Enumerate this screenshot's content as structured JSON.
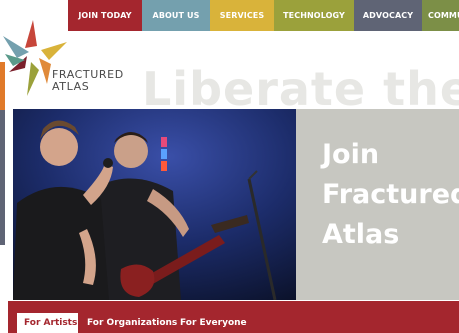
{
  "nav": {
    "items": [
      {
        "label": "JOIN TODAY",
        "color": "#a4262e"
      },
      {
        "label": "ABOUT US",
        "color": "#74a0ae"
      },
      {
        "label": "SERVICES",
        "color": "#d9b33a"
      },
      {
        "label": "TECHNOLOGY",
        "color": "#9ba13b"
      },
      {
        "label": "ADVOCACY",
        "color": "#5f6475"
      },
      {
        "label": "COMMU",
        "color": "#7c8f47"
      }
    ]
  },
  "logo": {
    "line1": "FRACTURED",
    "line2": "ATLAS"
  },
  "slogan": "Liberate the",
  "hero": {
    "title_line1": "Join",
    "title_line2": "Fractured",
    "title_line3": "Atlas",
    "photo_icon": "band-performance-photo"
  },
  "tabs": [
    {
      "label": "For Artists",
      "active": true
    },
    {
      "label": "For Organizations",
      "active": false
    },
    {
      "label": "For Everyone",
      "active": false
    }
  ],
  "colors": {
    "brand_red": "#a4262e",
    "hero_gray": "#c7c7c1"
  }
}
